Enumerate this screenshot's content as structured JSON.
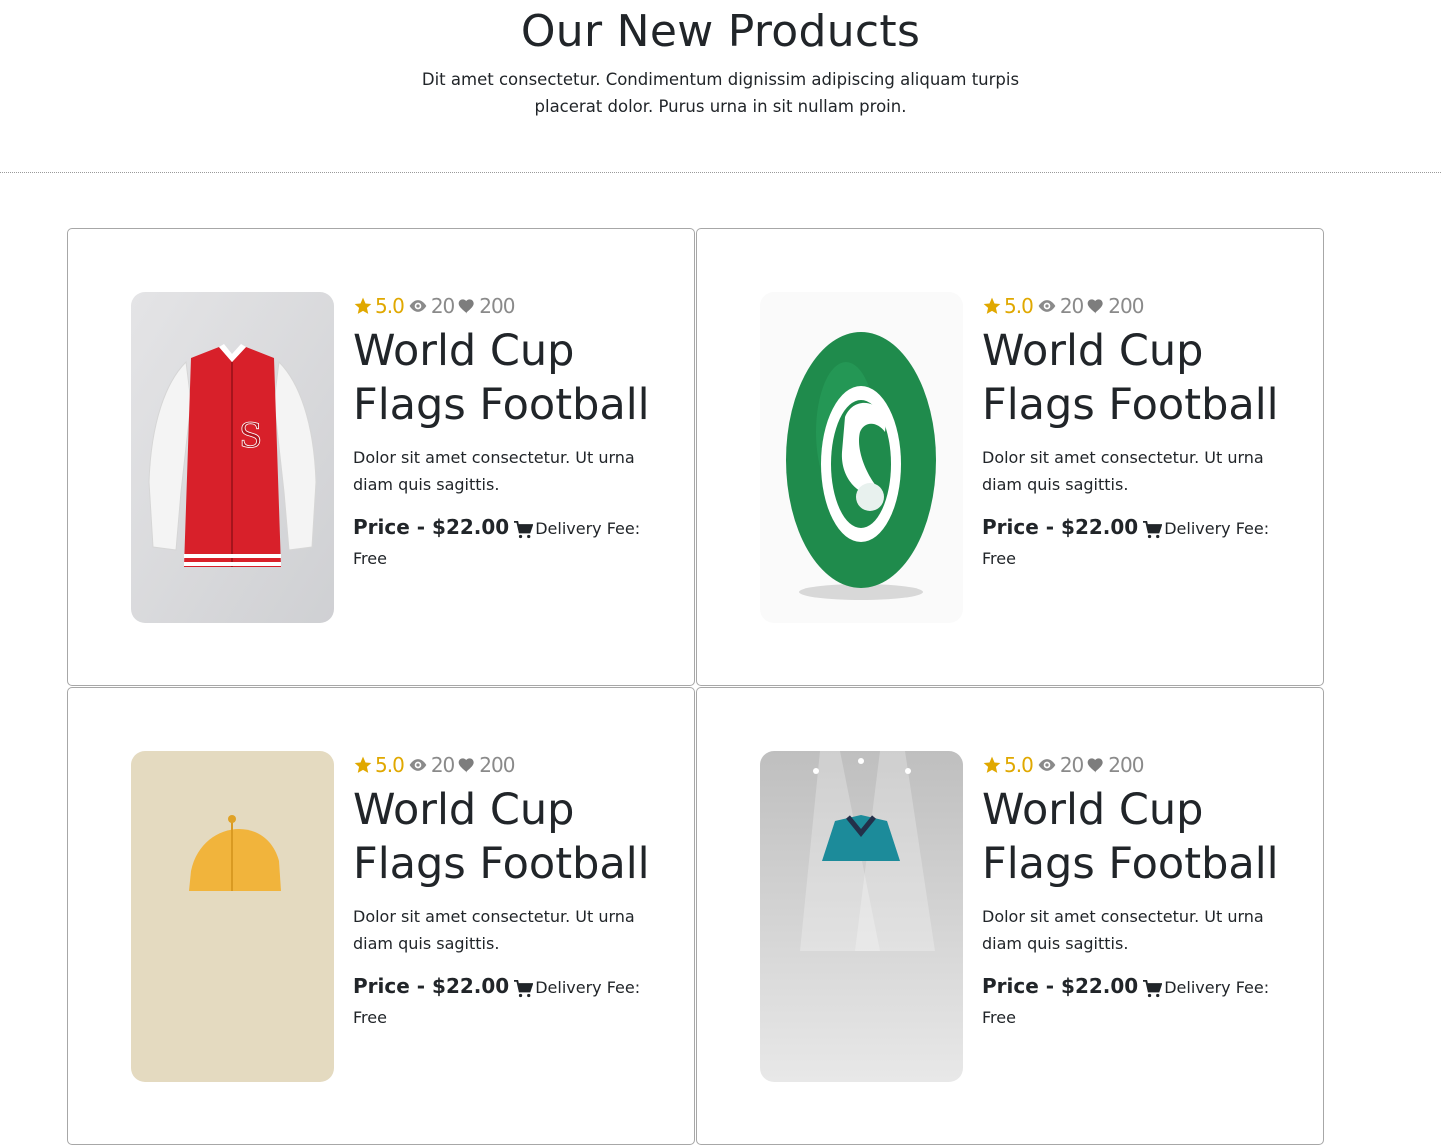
{
  "header": {
    "title": "Our New Products",
    "subtitle": "Dit amet consectetur. Condimentum dignissim adipiscing aliquam turpis placerat dolor. Purus urna in sit nullam proin."
  },
  "colors": {
    "rating": "#e0a800",
    "muted": "#8a8a8a",
    "text": "#212529",
    "border": "#a7a7a7"
  },
  "products": [
    {
      "image": "red-varsity-jacket",
      "rating": "5.0",
      "views": "20",
      "likes": "200",
      "name": "World Cup Flags Football",
      "description": "Dolor sit amet consectetur. Ut urna diam quis sagittis.",
      "price": "Price - $22.00",
      "delivery": "Delivery Fee: Free"
    },
    {
      "image": "green-football",
      "rating": "5.0",
      "views": "20",
      "likes": "200",
      "name": "World Cup Flags Football",
      "description": "Dolor sit amet consectetur. Ut urna diam quis sagittis.",
      "price": "Price - $22.00",
      "delivery": "Delivery Fee: Free"
    },
    {
      "image": "yellow-cap",
      "rating": "5.0",
      "views": "20",
      "likes": "200",
      "name": "World Cup Flags Football",
      "description": "Dolor sit amet consectetur. Ut urna diam quis sagittis.",
      "price": "Price - $22.00",
      "delivery": "Delivery Fee: Free"
    },
    {
      "image": "teal-jersey",
      "rating": "5.0",
      "views": "20",
      "likes": "200",
      "name": "World Cup Flags Football",
      "description": "Dolor sit amet consectetur. Ut urna diam quis sagittis.",
      "price": "Price - $22.00",
      "delivery": "Delivery Fee: Free"
    }
  ]
}
